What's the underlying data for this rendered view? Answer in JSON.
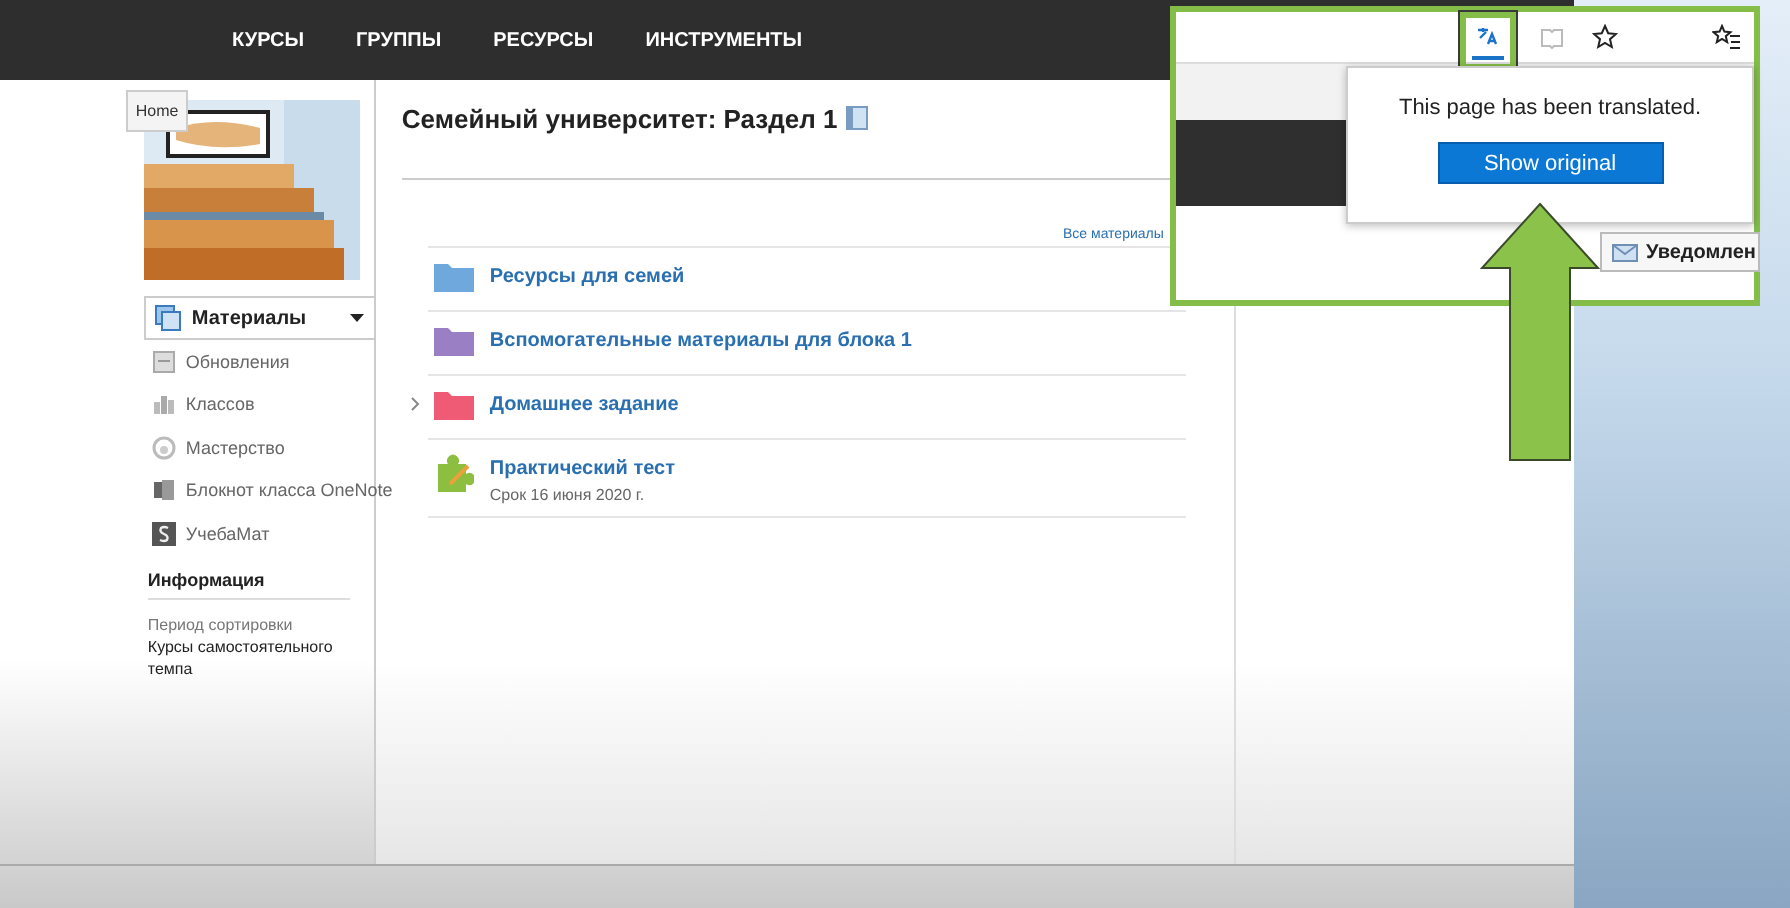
{
  "nav": {
    "items": [
      "КУРСЫ",
      "ГРУППЫ",
      "РЕСУРСЫ",
      "ИНСТРУМЕНТЫ"
    ]
  },
  "tooltip": "Home",
  "sidebar": {
    "menu": {
      "label": "Материалы",
      "expanded": false
    },
    "items": [
      {
        "kind": "updates",
        "label": "Обновления"
      },
      {
        "kind": "classes",
        "label": "Классов"
      },
      {
        "kind": "mastery",
        "label": "Мастерство"
      },
      {
        "kind": "onenote",
        "label": "Блокнот класса OneNote"
      },
      {
        "kind": "s",
        "label": "УчебаМат"
      }
    ],
    "info": {
      "heading": "Информация",
      "label": "Период сортировки",
      "value": "Курсы самостоятельного темпа"
    }
  },
  "main": {
    "title": "Семейный университет: Раздел 1",
    "all_link": "Все материалы",
    "items": [
      {
        "kind": "folder",
        "title": "Ресурсы для семей",
        "color": "#6fa8dc",
        "has_children": false
      },
      {
        "kind": "folder",
        "title": "Вспомогательные материалы для блока 1",
        "color": "#9a7fc4",
        "has_children": false
      },
      {
        "kind": "folder",
        "title": "Домашнее задание",
        "color": "#ef5b75",
        "has_children": true
      },
      {
        "kind": "assignment",
        "title": "Практический тест",
        "subtitle": "Срок 16 июня 2020 г.",
        "has_children": false
      }
    ]
  },
  "callout": {
    "toolbar": [
      {
        "kind": "translate",
        "selected": true
      },
      {
        "kind": "reading",
        "selected": false
      },
      {
        "kind": "star",
        "selected": false
      },
      {
        "kind": "favorites",
        "selected": false
      }
    ],
    "popup": {
      "message": "This page has been translated.",
      "button": "Show original"
    },
    "notify_button": "Уведомлен"
  }
}
